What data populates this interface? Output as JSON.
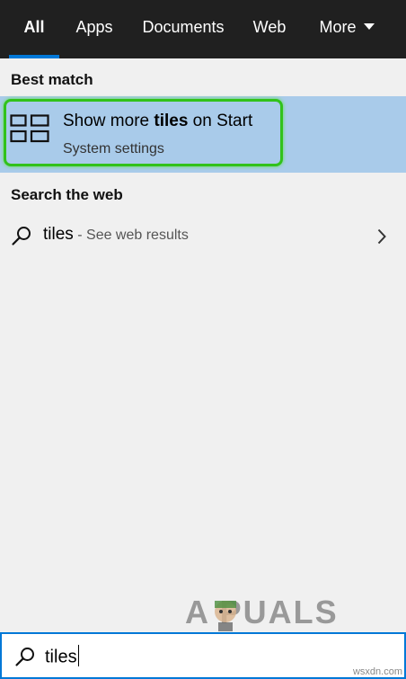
{
  "tabs": [
    {
      "label": "All",
      "active": true
    },
    {
      "label": "Apps"
    },
    {
      "label": "Documents"
    },
    {
      "label": "Web"
    },
    {
      "label": "More"
    }
  ],
  "best_match": {
    "heading": "Best match",
    "title_prefix": "Show more ",
    "title_bold": "tiles",
    "title_suffix": " on Start",
    "subtitle": "System settings",
    "icon": "tiles-layout-icon"
  },
  "web": {
    "heading": "Search the web",
    "query": "tiles",
    "suffix": " - See web results"
  },
  "search": {
    "value": "tiles",
    "icon": "search-icon"
  },
  "watermark": {
    "text": "A  PUALS"
  },
  "credit": "wsxdn.com",
  "colors": {
    "accent": "#0078d7",
    "highlight": "#31c21a",
    "selected_bg": "#a9cbea"
  }
}
